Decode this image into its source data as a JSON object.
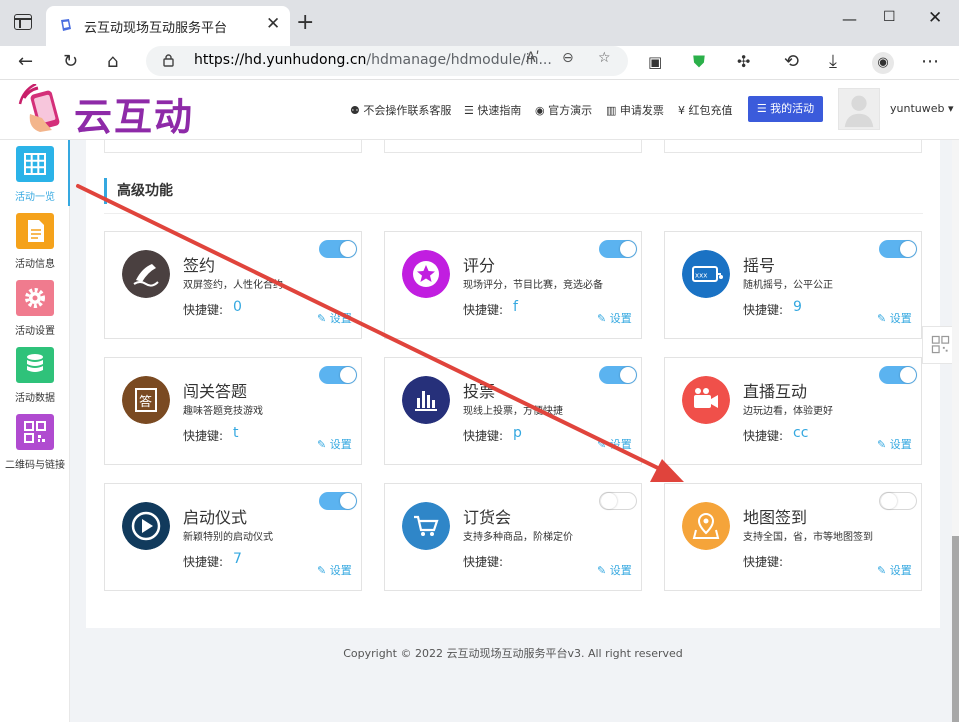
{
  "browser": {
    "tab_title": "云互动现场互动服务平台",
    "url_host": "https://hd.yunhudong.cn",
    "url_rest": "/hdmanage/hdmodule/in...",
    "reader_label": "Aʹ"
  },
  "header": {
    "logo_text": "云互动",
    "links": [
      {
        "icon": "user-plus-icon",
        "label": "不会操作联系客服"
      },
      {
        "icon": "list-icon",
        "label": "快速指南"
      },
      {
        "icon": "play-circle-icon",
        "label": "官方演示"
      },
      {
        "icon": "barcode-icon",
        "label": "申请发票"
      },
      {
        "icon": "yen-icon",
        "label": "红包充值"
      }
    ],
    "my_activity": "我的活动",
    "user_name": "yuntuweb"
  },
  "sidebar": {
    "items": [
      {
        "label": "活动一览",
        "color": "#2bb3e8",
        "icon": "grid-icon"
      },
      {
        "label": "活动信息",
        "color": "#f5a21b",
        "icon": "document-icon"
      },
      {
        "label": "活动设置",
        "color": "#f07b8e",
        "icon": "gear-icon"
      },
      {
        "label": "活动数据",
        "color": "#2fc27a",
        "icon": "database-icon"
      },
      {
        "label": "二维码与链接",
        "color": "#b04bd0",
        "icon": "qrcode-icon"
      }
    ]
  },
  "section": {
    "title": "高级功能",
    "key_label": "快捷键:",
    "setting_label": "设置"
  },
  "cards": [
    {
      "name": "签约",
      "desc": "双屏签约，人性化合约",
      "key": "0",
      "enabled": true,
      "color": "#4a4040",
      "icon": "sign-icon"
    },
    {
      "name": "评分",
      "desc": "现场评分，节目比赛，竞选必备",
      "key": "f",
      "enabled": true,
      "color": "#c11ee0",
      "icon": "star-icon"
    },
    {
      "name": "摇号",
      "desc": "随机摇号，公平公正",
      "key": "9",
      "enabled": true,
      "color": "#1a72c4",
      "icon": "lottery-icon"
    },
    {
      "name": "闯关答题",
      "desc": "趣味答题竞技游戏",
      "key": "t",
      "enabled": true,
      "color": "#7a4a22",
      "icon": "quiz-icon"
    },
    {
      "name": "投票",
      "desc": "现线上投票，方便快捷",
      "key": "p",
      "enabled": true,
      "color": "#26307a",
      "icon": "bar-chart-icon"
    },
    {
      "name": "直播互动",
      "desc": "边玩边看，体验更好",
      "key": "cc",
      "enabled": true,
      "color": "#f0504a",
      "icon": "video-camera-icon"
    },
    {
      "name": "启动仪式",
      "desc": "新颖特别的启动仪式",
      "key": "7",
      "enabled": true,
      "color": "#113a5c",
      "icon": "play-icon"
    },
    {
      "name": "订货会",
      "desc": "支持多种商品，阶梯定价",
      "key": "",
      "enabled": false,
      "color": "#2f86c8",
      "icon": "cart-icon"
    },
    {
      "name": "地图签到",
      "desc": "支持全国，省，市等地图签到",
      "key": "",
      "enabled": false,
      "color": "#f5a43a",
      "icon": "map-pin-icon"
    }
  ],
  "footer": {
    "copyright": "Copyright © 2022 云互动现场互动服务平台v3. All right reserved"
  }
}
